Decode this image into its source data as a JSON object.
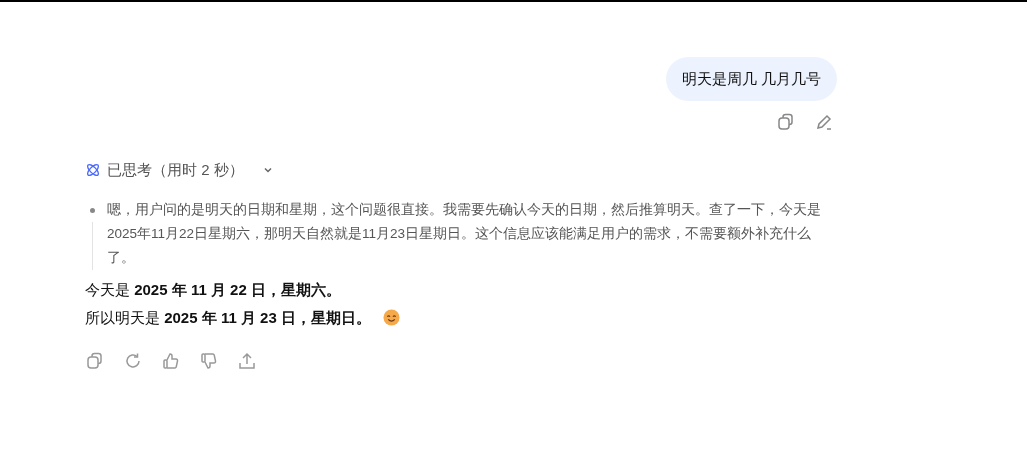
{
  "user_message": {
    "text": "明天是周几 几月几号"
  },
  "thinking": {
    "label": "已思考（用时 2 秒）",
    "expanded": true,
    "steps": [
      "嗯，用户问的是明天的日期和星期，这个问题很直接。我需要先确认今天的日期，然后推算明天。查了一下，今天是2025年11月22日星期六，那明天自然就是11月23日星期日。这个信息应该能满足用户的需求，不需要额外补充什么了。"
    ]
  },
  "answer": {
    "lines": [
      "今天是 **2025 年 11 月 22 日，星期六。**",
      "所以明天是 **2025 年 11 月 23 日，星期日。**"
    ]
  }
}
